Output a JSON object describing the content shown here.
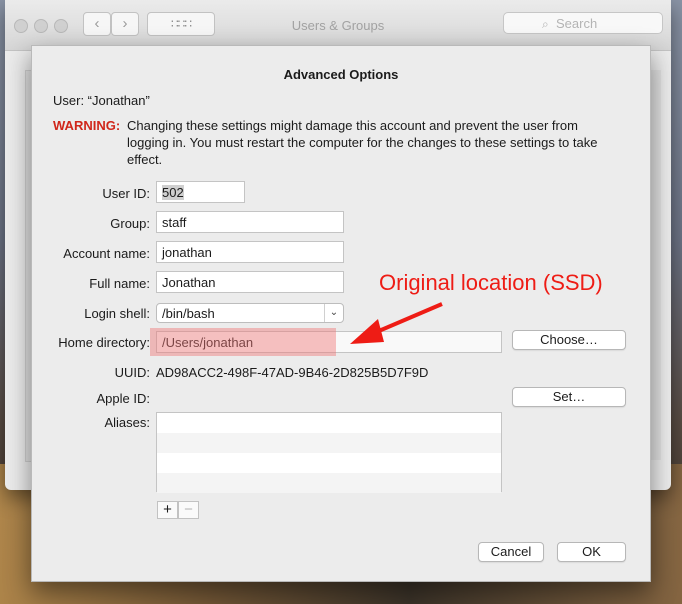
{
  "window": {
    "title": "Users & Groups",
    "search_placeholder": "Search",
    "grid_glyph": "∷∷∷",
    "back_glyph": "‹",
    "forward_glyph": "›",
    "search_glyph": "⌕"
  },
  "dialog": {
    "title": "Advanced Options",
    "user_line": "User:  “Jonathan”",
    "warning_label": "WARNING:",
    "warning_text": "Changing these settings might damage this account and prevent the user from logging in. You must restart the computer for the changes to these settings to take effect.",
    "fields": {
      "user_id": {
        "label": "User ID:",
        "value": "502"
      },
      "group": {
        "label": "Group:",
        "value": "staff"
      },
      "account_name": {
        "label": "Account name:",
        "value": "jonathan"
      },
      "full_name": {
        "label": "Full name:",
        "value": "Jonathan"
      },
      "login_shell": {
        "label": "Login shell:",
        "value": "/bin/bash",
        "chevron": "⌄"
      },
      "home_directory": {
        "label": "Home directory:",
        "value": "/Users/jonathan"
      },
      "uuid": {
        "label": "UUID:",
        "value": "AD98ACC2-498F-47AD-9B46-2D825B5D7F9D"
      },
      "apple_id": {
        "label": "Apple ID:",
        "value": ""
      },
      "aliases": {
        "label": "Aliases:"
      }
    },
    "buttons": {
      "choose": "Choose…",
      "set": "Set…",
      "cancel": "Cancel",
      "ok": "OK",
      "add": "+",
      "remove": "−"
    }
  },
  "annotation": {
    "text": "Original location (SSD)",
    "color": "#ee1c15"
  },
  "colors": {
    "warning": "#d0261a",
    "highlight": "#f07878"
  }
}
